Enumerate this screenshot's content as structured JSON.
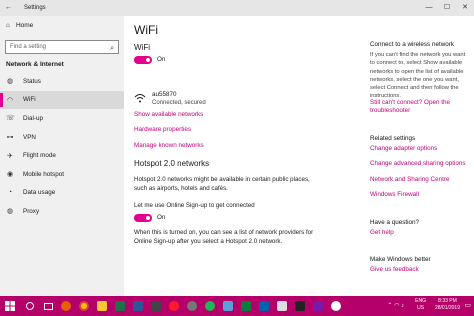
{
  "window": {
    "title": "Settings",
    "controls": [
      "—",
      "☐",
      "✕"
    ]
  },
  "sidebar": {
    "home_label": "Home",
    "search_placeholder": "Find a setting",
    "section_title": "Network & Internet",
    "items": [
      {
        "label": "Status",
        "icon": "globe-icon"
      },
      {
        "label": "WiFi",
        "icon": "wifi-icon",
        "active": true
      },
      {
        "label": "Dial-up",
        "icon": "dialup-icon"
      },
      {
        "label": "VPN",
        "icon": "vpn-icon"
      },
      {
        "label": "Flight mode",
        "icon": "airplane-icon"
      },
      {
        "label": "Mobile hotspot",
        "icon": "hotspot-icon"
      },
      {
        "label": "Data usage",
        "icon": "data-usage-icon"
      },
      {
        "label": "Proxy",
        "icon": "globe-icon"
      }
    ]
  },
  "main": {
    "title": "WiFi",
    "wifi_section": "WiFi",
    "wifi_toggle_label": "On",
    "network": {
      "name": "au55870",
      "status": "Connected, secured"
    },
    "links": {
      "show_networks": "Show available networks",
      "hardware": "Hardware properties",
      "manage_known": "Manage known networks"
    },
    "hotspot": {
      "title": "Hotspot 2.0 networks",
      "description": "Hotspot 2.0 networks might be available in certain public places, such as airports, hotels and cafés.",
      "signup_label": "Let me use Online Sign-up to get connected",
      "toggle_label": "On",
      "note": "When this is turned on, you can see a list of network providers for Online Sign-up after you select a Hotspot 2.0 network."
    }
  },
  "right": {
    "connect_title": "Connect to a wireless network",
    "connect_text": "If you can't find the network you want to connect to, select Show available networks to open the list of available networks, select the one you want, select Connect and then follow the instructions.",
    "cant_connect_link": "Still can't connect? Open the troubleshooter",
    "related_title": "Related settings",
    "related_links": [
      "Change adapter options",
      "Change advanced sharing options",
      "Network and Sharing Centre",
      "Windows Firewall"
    ],
    "question_title": "Have a question?",
    "get_help": "Get help",
    "better_title": "Make Windows better",
    "feedback": "Give us feedback"
  },
  "taskbar": {
    "language": "ENG",
    "region": "US",
    "time": "8:33 PM",
    "date": "28/01/2019",
    "accent": "#b40068"
  }
}
